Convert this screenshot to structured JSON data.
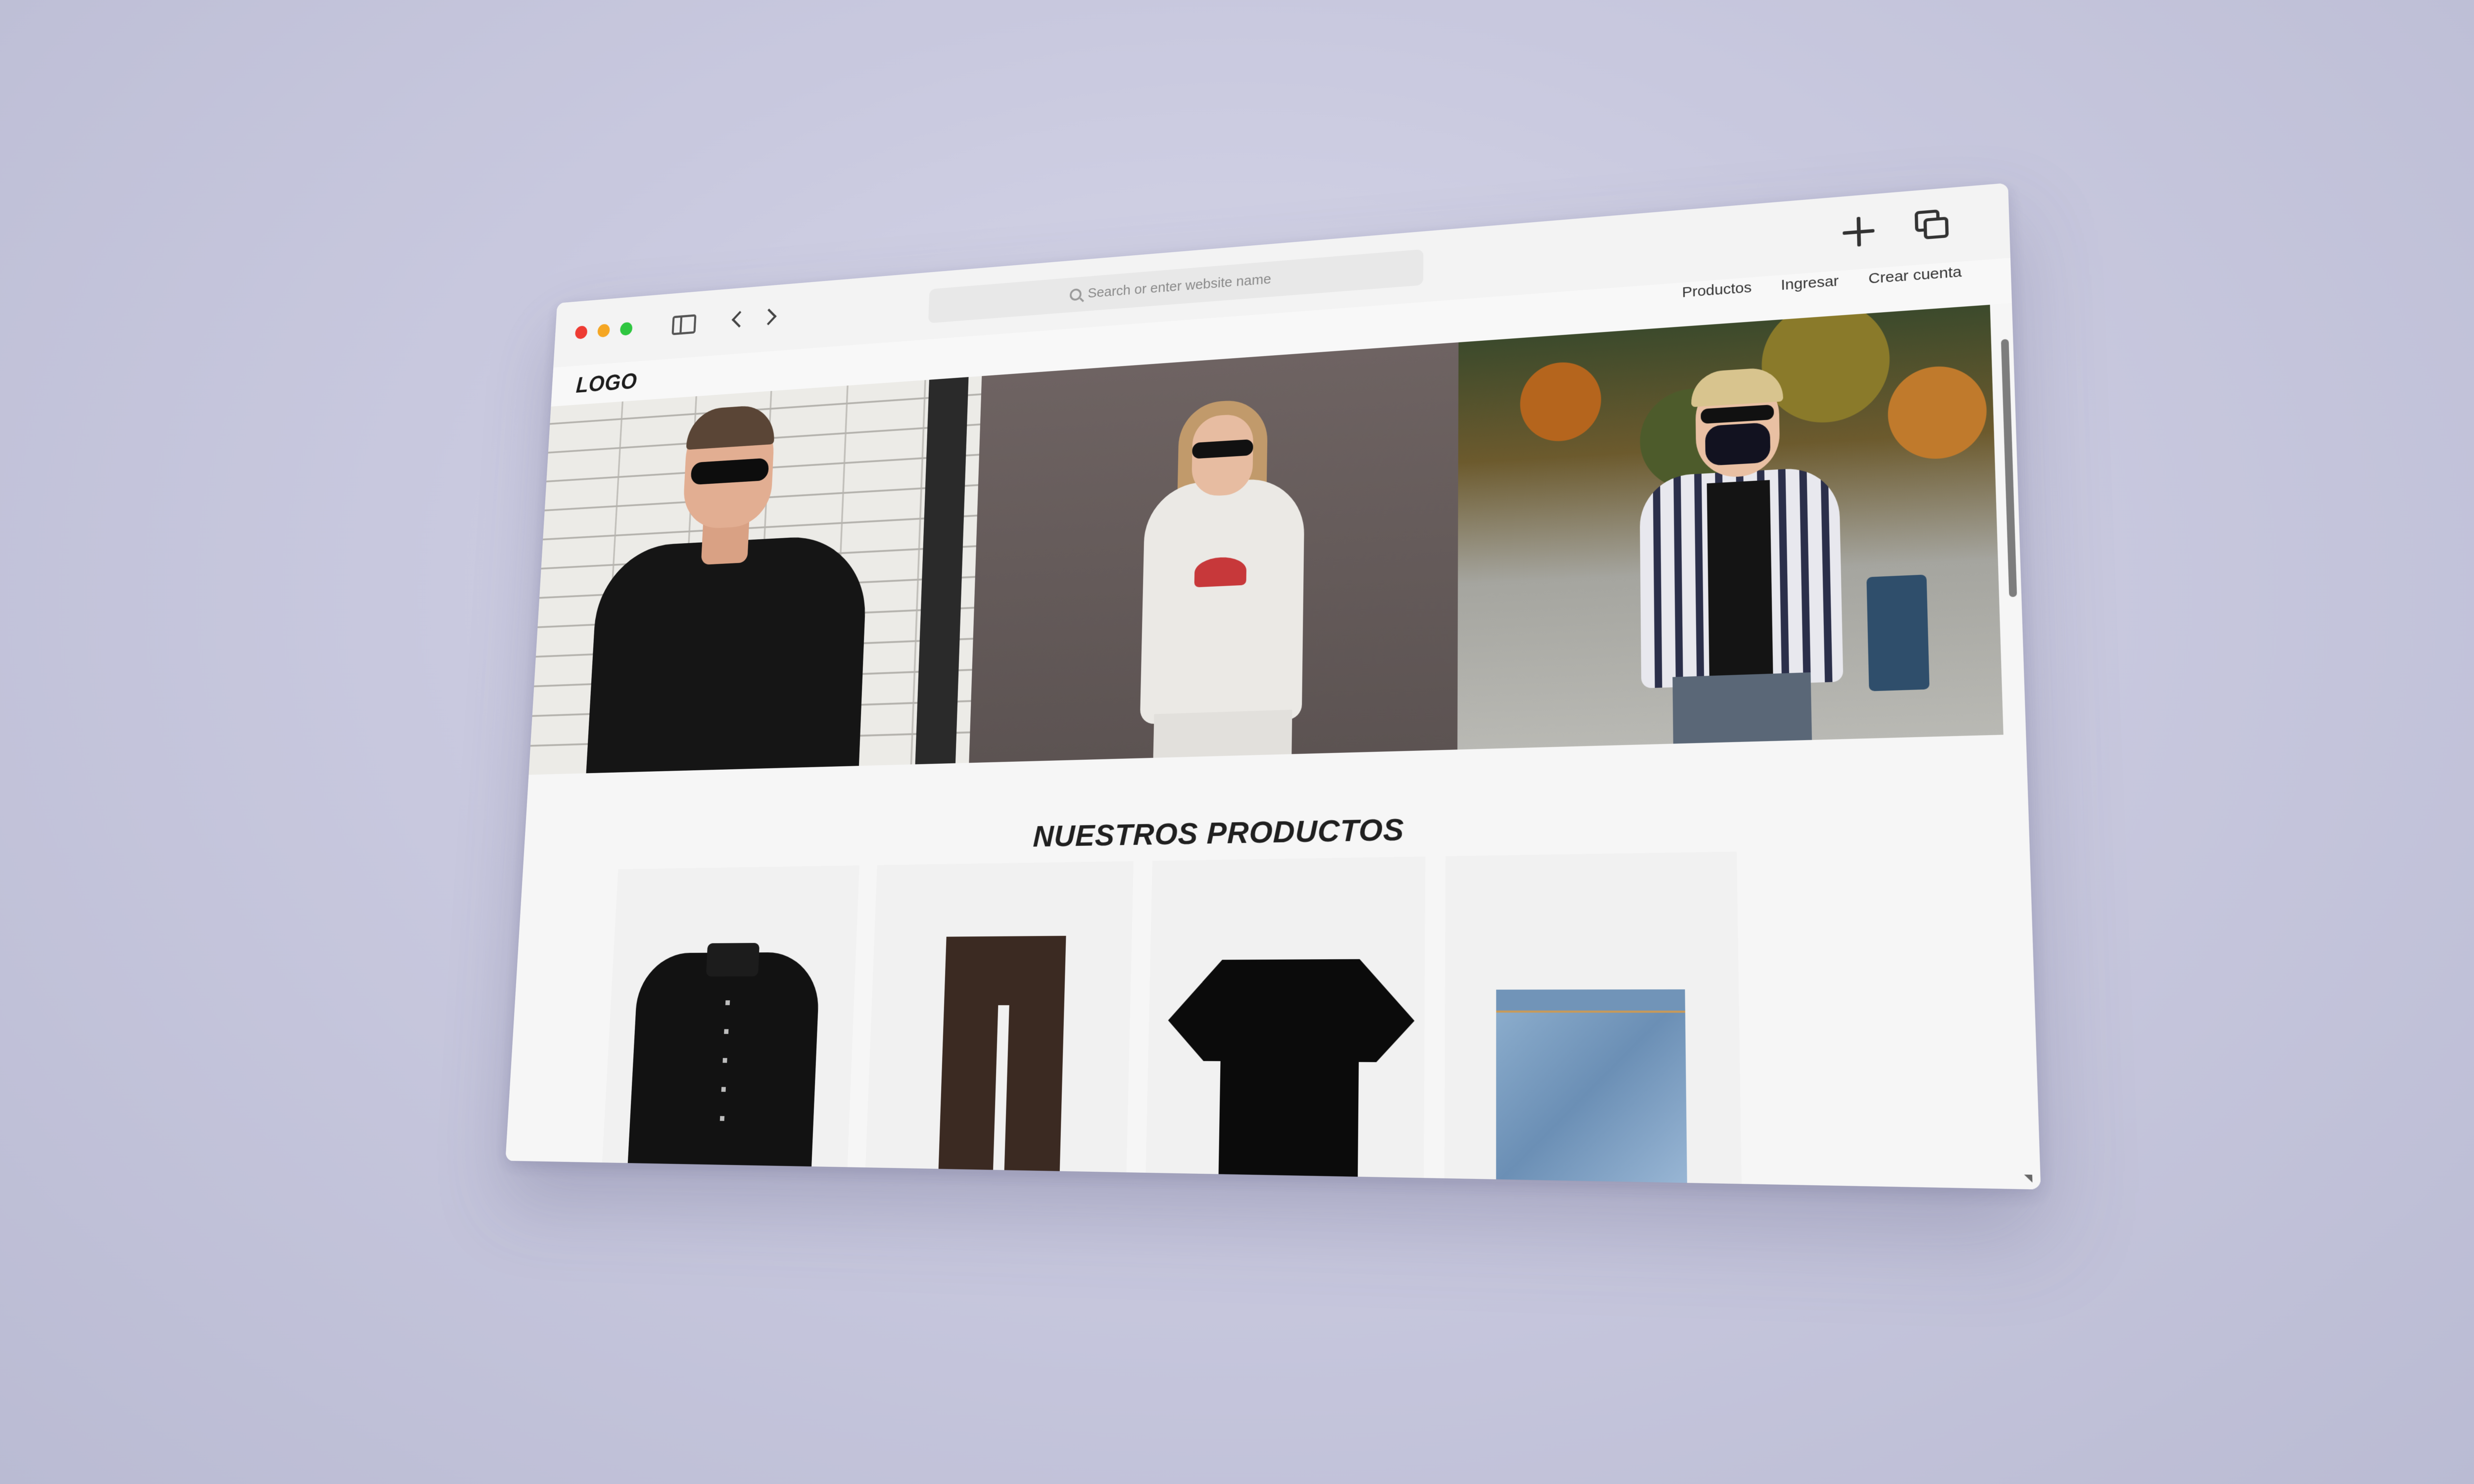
{
  "browser": {
    "address_placeholder": "Search or enter website name",
    "icons": [
      "sidebar-toggle-icon",
      "back-arrow-icon",
      "forward-arrow-icon",
      "search-icon",
      "plus-icon",
      "tabs-icon"
    ]
  },
  "site": {
    "logo": "LOGO",
    "nav": [
      "Productos",
      "Ingresar",
      "Crear cuenta"
    ],
    "section_title": "NUESTROS PRODUCTOS",
    "hero_images": [
      "man-black-tee-photo",
      "woman-white-hoodie-photo",
      "man-plaid-shirt-photo"
    ],
    "products": [
      "black-jacket",
      "brown-trousers",
      "black-tshirt",
      "blue-jeans"
    ]
  },
  "colors": {
    "background": "#c9c9df",
    "traffic_red": "#ee3b33",
    "traffic_yellow": "#f5a623",
    "traffic_green": "#2fc640"
  }
}
